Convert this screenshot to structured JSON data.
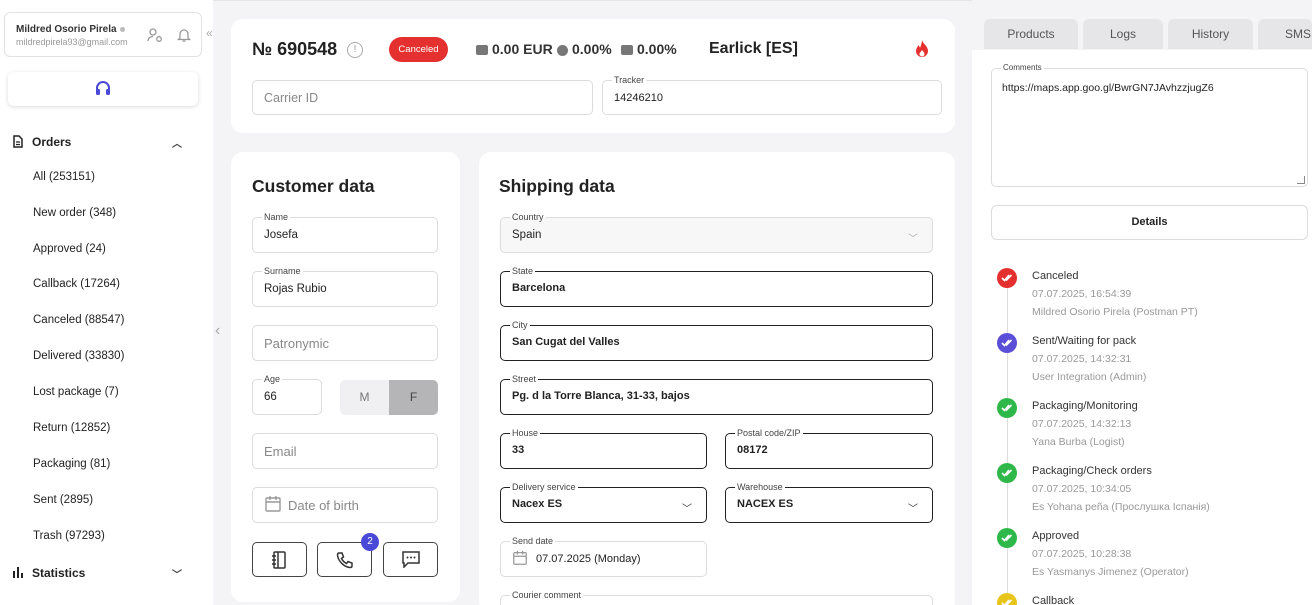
{
  "user": {
    "name": "Mildred Osorio Pirela",
    "email": "mildredpirela93@gmail.com"
  },
  "nav": {
    "orders_label": "Orders",
    "items": [
      "All (253151)",
      "New order (348)",
      "Approved (24)",
      "Callback (17264)",
      "Canceled (88547)",
      "Delivered (33830)",
      "Lost package (7)",
      "Return (12852)",
      "Packaging (81)",
      "Sent (2895)",
      "Trash (97293)"
    ],
    "statistics_label": "Statistics"
  },
  "order": {
    "number": "№ 690548",
    "status": "Canceled",
    "status_color": "#e53030",
    "amount": "0.00 EUR",
    "percent_a": "0.00%",
    "percent_b": "0.00%",
    "source": "Earlick [ES]",
    "carrier_id_placeholder": "Carrier ID",
    "tracker_label": "Tracker",
    "tracker_value": "14246210"
  },
  "customer": {
    "title": "Customer data",
    "name_label": "Name",
    "name": "Josefa",
    "surname_label": "Surname",
    "surname": "Rojas Rubio",
    "patronymic_placeholder": "Patronymic",
    "age_label": "Age",
    "age": "66",
    "gender_m": "M",
    "gender_f": "F",
    "gender_selected": "F",
    "email_placeholder": "Email",
    "dob_placeholder": "Date of birth",
    "call_badge": "2"
  },
  "shipping": {
    "title": "Shipping data",
    "country_label": "Country",
    "country": "Spain",
    "state_label": "State",
    "state": "Barcelona",
    "city_label": "City",
    "city": "San Cugat del Valles",
    "street_label": "Street",
    "street": "Pg. d la Torre Blanca, 31-33, bajos",
    "house_label": "House",
    "house": "33",
    "postal_label": "Postal code/ZIP",
    "postal": "08172",
    "delivery_label": "Delivery service",
    "delivery": "Nacex ES",
    "warehouse_label": "Warehouse",
    "warehouse": "NACEX ES",
    "send_date_label": "Send date",
    "send_date": "07.07.2025 (Monday)",
    "courier_comment_label": "Courier comment"
  },
  "right": {
    "tabs": [
      "Products",
      "Logs",
      "History",
      "SMS"
    ],
    "comments_label": "Comments",
    "comments": "https://maps.app.goo.gl/BwrGN7JAvhzzjugZ6",
    "details_label": "Details",
    "timeline": [
      {
        "title": "Canceled",
        "time": "07.07.2025, 16:54:39",
        "user": "Mildred Osorio Pirela (Postman PT)",
        "color": "#e53030"
      },
      {
        "title": "Sent/Waiting for pack",
        "time": "07.07.2025, 14:32:31",
        "user": "User Integration (Admin)",
        "color": "#5a4fd6"
      },
      {
        "title": "Packaging/Monitoring",
        "time": "07.07.2025, 14:32:13",
        "user": "Yana Burba (Logist)",
        "color": "#2fb84a"
      },
      {
        "title": "Packaging/Check orders",
        "time": "07.07.2025, 10:34:05",
        "user": "Es Yohana peña (Прослушка Іспанія)",
        "color": "#2fb84a"
      },
      {
        "title": "Approved",
        "time": "07.07.2025, 10:28:38",
        "user": "Es Yasmanys Jimenez (Operator)",
        "color": "#2fb84a"
      },
      {
        "title": "Callback",
        "time": "",
        "user": "",
        "color": "#e8c51a"
      }
    ]
  }
}
